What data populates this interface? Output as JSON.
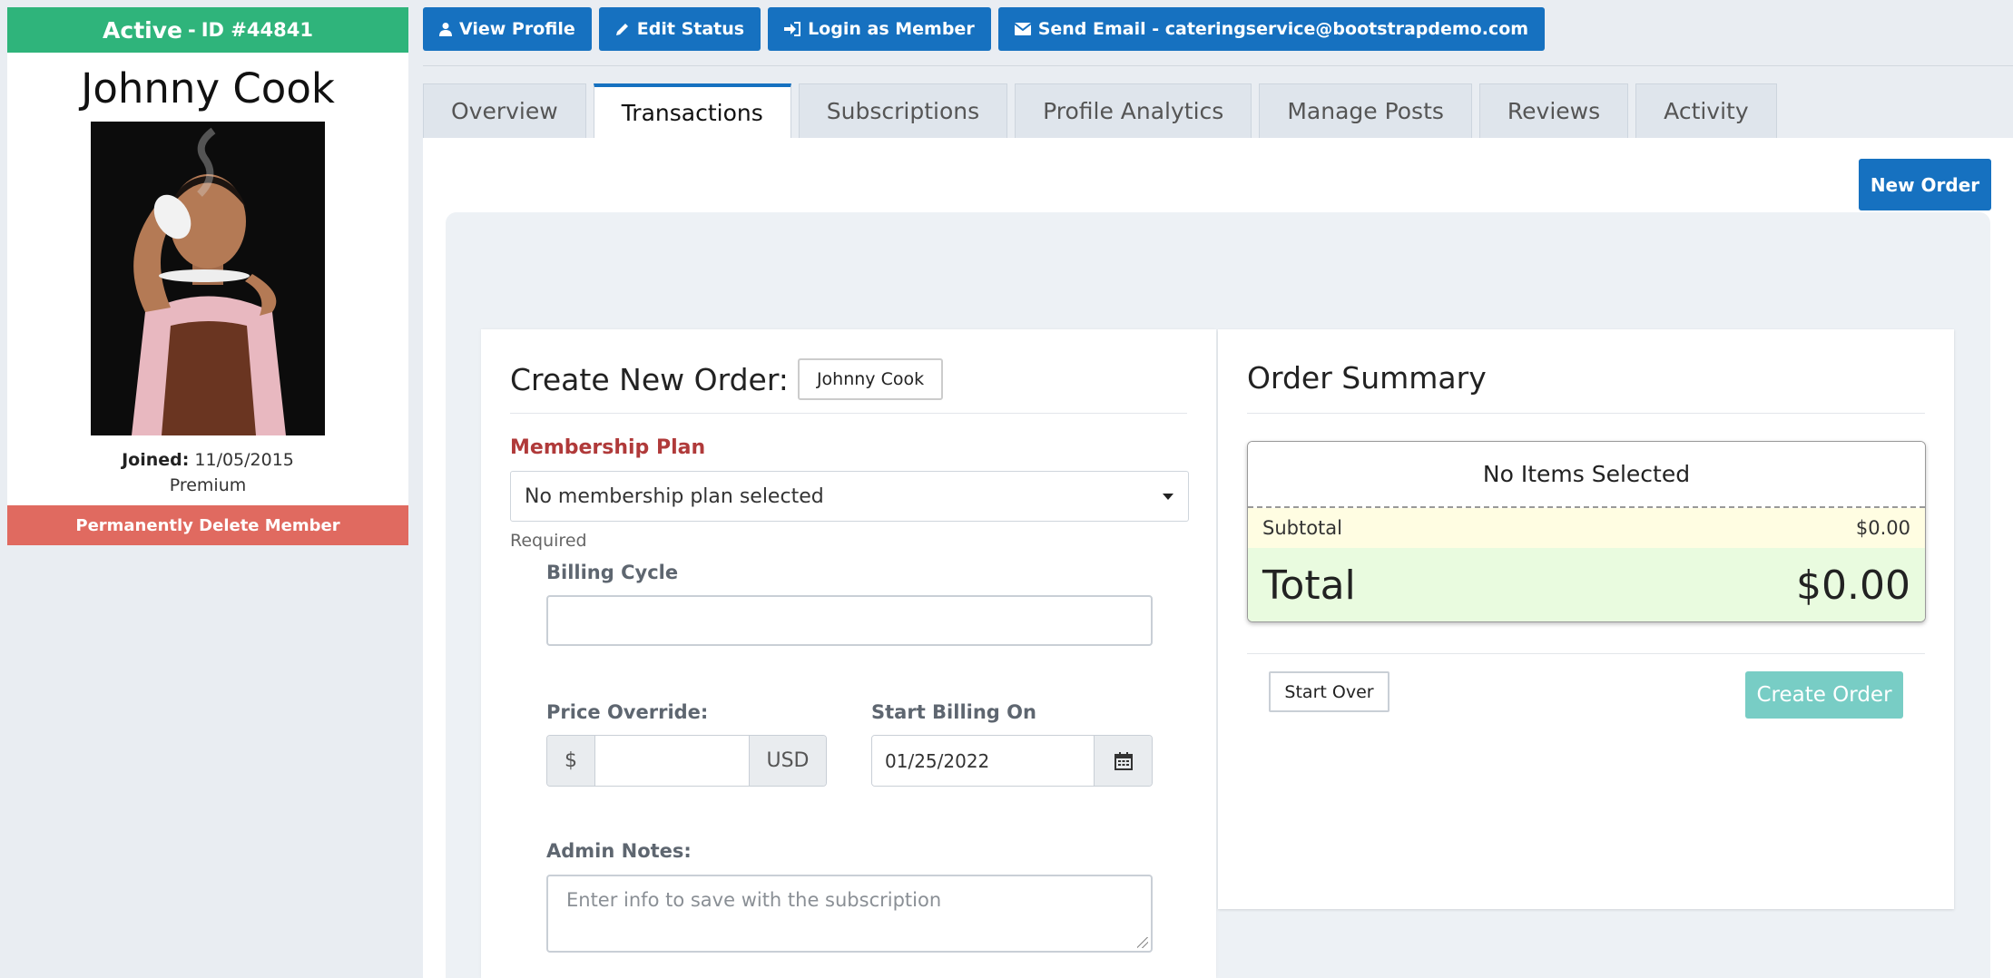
{
  "member": {
    "status": "Active",
    "id_label": "ID #44841",
    "name": "Johnny Cook",
    "joined_label": "Joined:",
    "joined_date": "11/05/2015",
    "plan_level": "Premium",
    "delete_label": "Permanently Delete Member"
  },
  "actions": [
    {
      "label": "View Profile",
      "icon": "user-icon"
    },
    {
      "label": "Edit Status",
      "icon": "pencil-icon"
    },
    {
      "label": "Login as Member",
      "icon": "sign-in-icon"
    },
    {
      "label": "Send Email - cateringservice@bootstrapdemo.com",
      "icon": "envelope-icon"
    }
  ],
  "tabs": [
    "Overview",
    "Transactions",
    "Subscriptions",
    "Profile Analytics",
    "Manage Posts",
    "Reviews",
    "Activity"
  ],
  "active_tab": "Transactions",
  "new_order_label": "New Order",
  "create_order": {
    "title": "Create New Order:",
    "member_chip": "Johnny Cook",
    "plan_label": "Membership Plan",
    "plan_value": "No membership plan selected",
    "required_note": "Required",
    "billing_cycle_label": "Billing Cycle",
    "billing_cycle_value": "",
    "price_override_label": "Price Override:",
    "currency_symbol": "$",
    "currency_code": "USD",
    "price_value": "",
    "start_billing_label": "Start Billing On",
    "start_billing_value": "01/25/2022",
    "admin_notes_label": "Admin Notes:",
    "admin_notes_placeholder": "Enter info to save with the subscription"
  },
  "summary": {
    "title": "Order Summary",
    "no_items": "No Items Selected",
    "subtotal_label": "Subtotal",
    "subtotal_value": "$0.00",
    "total_label": "Total",
    "total_value": "$0.00",
    "start_over_label": "Start Over",
    "create_order_label": "Create Order"
  },
  "colors": {
    "status_green": "#2fb47b",
    "primary_blue": "#1671c0",
    "danger_red": "#e06a60",
    "plan_label_red": "#b03a3a",
    "create_order_teal": "#78cdc5"
  }
}
